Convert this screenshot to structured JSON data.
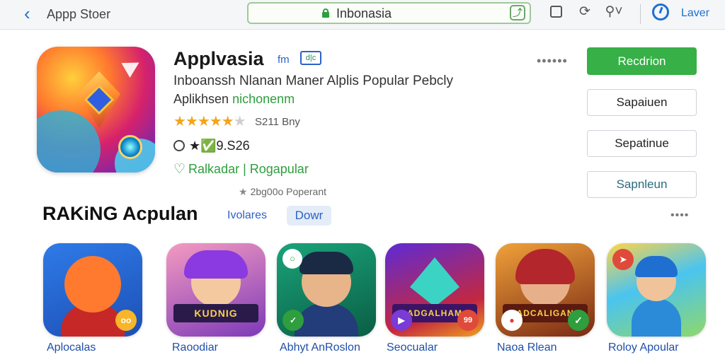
{
  "topbar": {
    "back_label": "Appp Stoer",
    "url": "Inbonasia",
    "account_label": "Laver"
  },
  "hero": {
    "title": "Applvasia",
    "title_tag": "fm",
    "title_badge": "d|c",
    "subtitle": "Inboanssh Nlanan Maner Alplis Popular Pebcly",
    "subtitle2_prefix": "Aplikhsen ",
    "subtitle2_highlight": "nichonenm",
    "rating_stars": 4.5,
    "rating_count": "S211 Bny",
    "price": "★✅9.S26",
    "popular": "Ralkadar | Rogapular",
    "downloads": "2bg00o Poperant",
    "more_dots": "••••••",
    "buttons": {
      "primary": "Recdrion",
      "secondary_1": "Sapaiuen",
      "secondary_2": "Sepatinue",
      "secondary_3": "Sapnleun"
    }
  },
  "ranking": {
    "title": "RAKiNG Acpulan",
    "segments": [
      "Ivolares",
      "Dowr"
    ],
    "more": "••••",
    "apps": [
      {
        "label": "Aplocalas",
        "badge": "oo"
      },
      {
        "label": "Raoodiar",
        "band": "KUDNIG"
      },
      {
        "label": "Abhyt AnRoslon",
        "badge": "✓"
      },
      {
        "label": "Seocualar",
        "band": "ADGALHAM",
        "badge": "99"
      },
      {
        "label": "Naoa Rlean",
        "band": "ADCALIGAN"
      },
      {
        "label": "Roloy Apoular"
      }
    ]
  },
  "colors": {
    "accent_blue": "#1f6fd1",
    "primary_green": "#37b047",
    "star_gold": "#f4a418"
  }
}
